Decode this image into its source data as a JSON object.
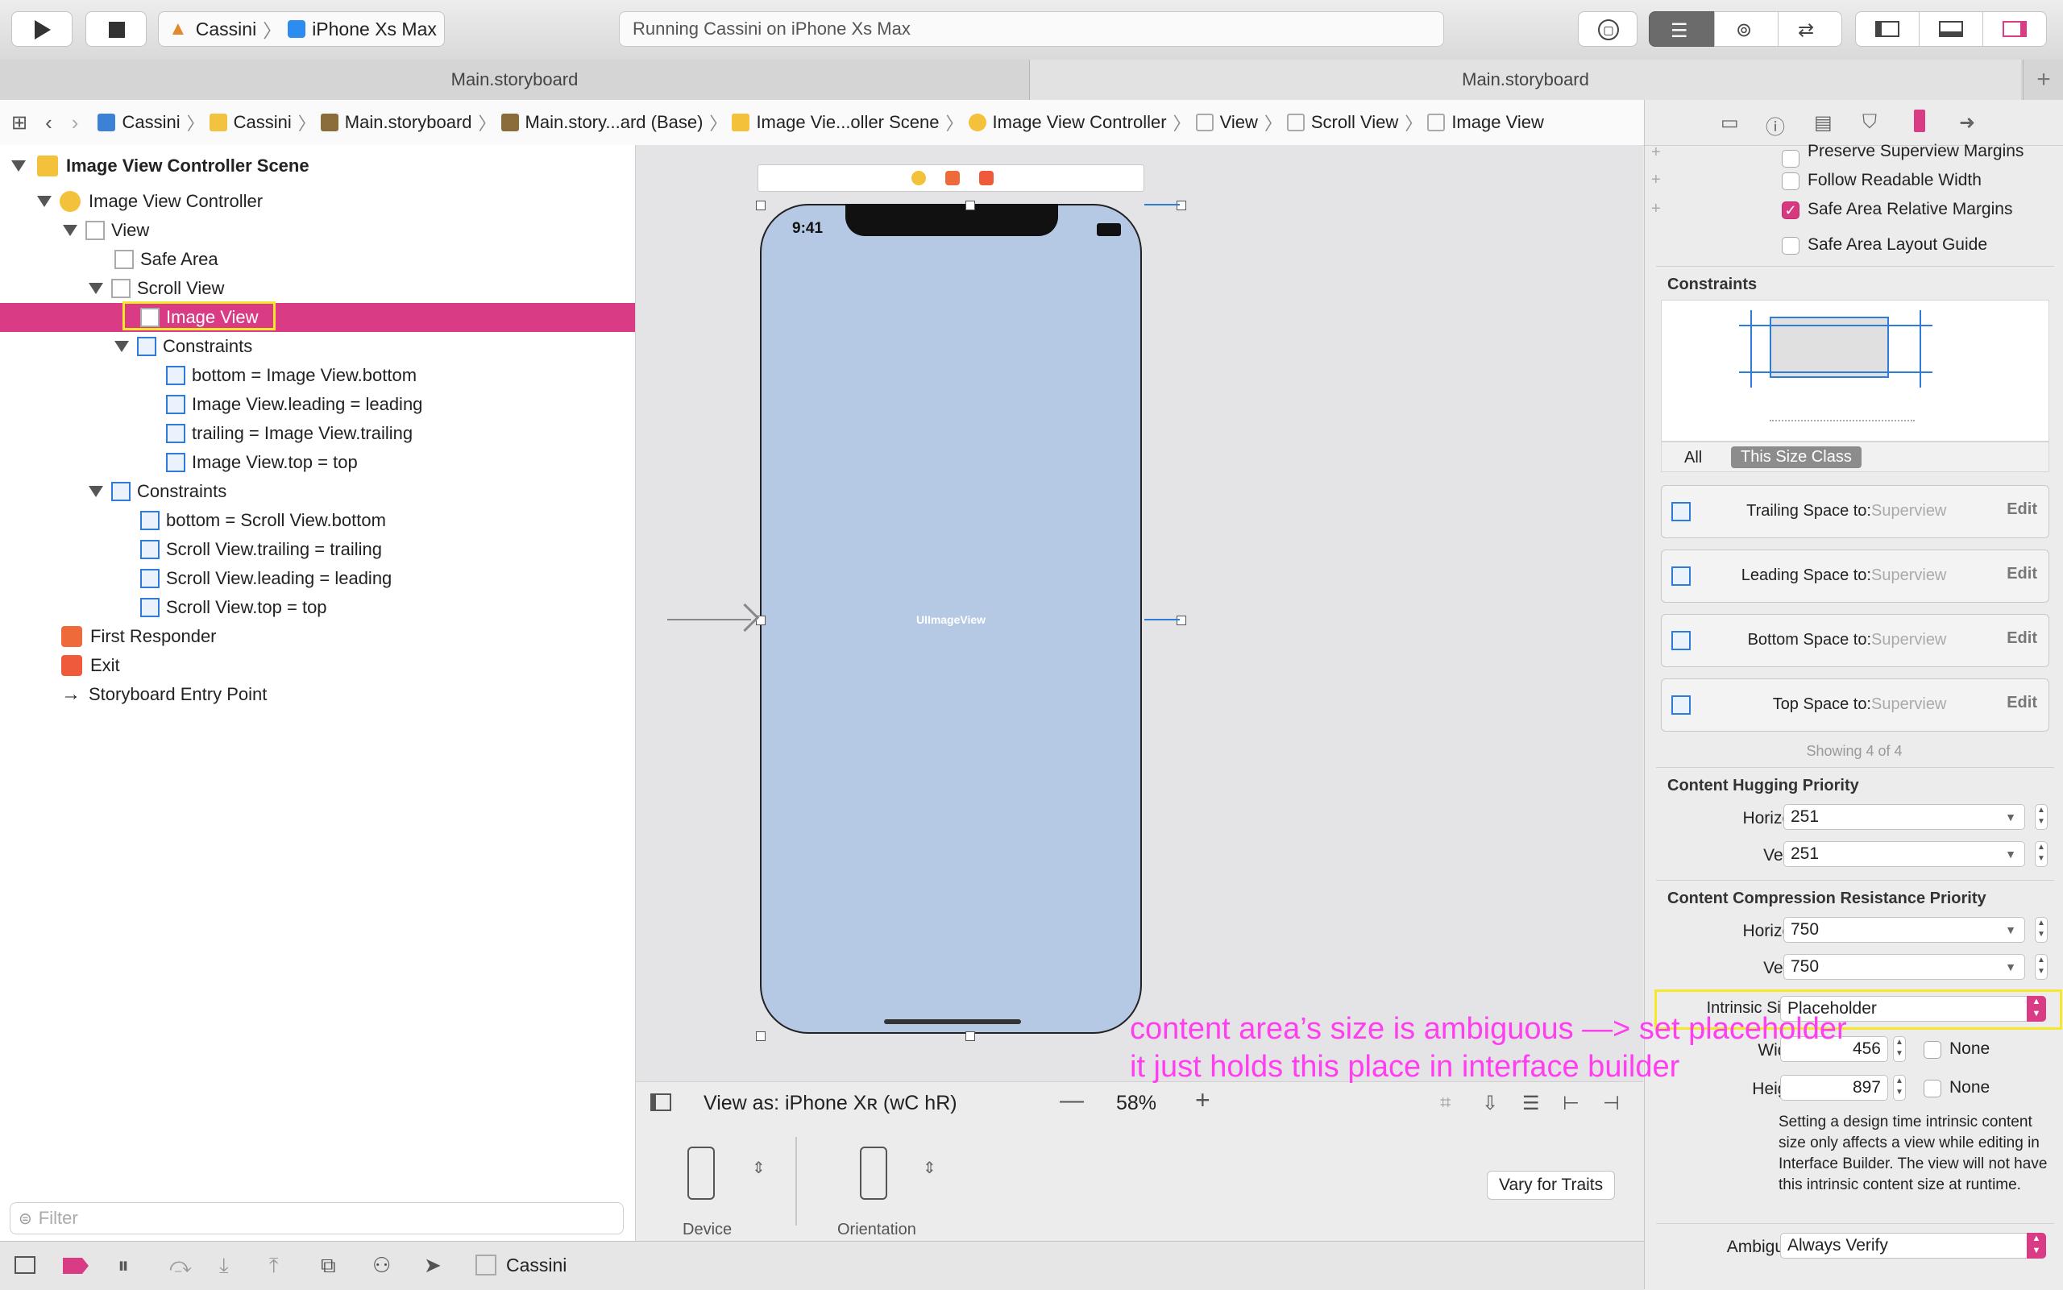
{
  "toolbar": {
    "scheme_project": "Cassini",
    "scheme_device": "iPhone Xs Max",
    "status": "Running Cassini on iPhone Xs Max"
  },
  "tabs": [
    "Main.storyboard",
    "Main.storyboard"
  ],
  "jumpbar": [
    "Cassini",
    "Cassini",
    "Main.storyboard",
    "Main.story...ard (Base)",
    "Image Vie...oller Scene",
    "Image View Controller",
    "View",
    "Scroll View",
    "Image View"
  ],
  "outline": {
    "scene": "Image View Controller Scene",
    "controller": "Image View Controller",
    "view": "View",
    "safe_area": "Safe Area",
    "scroll_view": "Scroll View",
    "image_view": "Image View",
    "constraints_label": "Constraints",
    "iv_constraints": [
      "bottom = Image View.bottom",
      "Image View.leading = leading",
      "trailing = Image View.trailing",
      "Image View.top = top"
    ],
    "sv_constraints": [
      "bottom = Scroll View.bottom",
      "Scroll View.trailing = trailing",
      "Scroll View.leading = leading",
      "Scroll View.top = top"
    ],
    "first_responder": "First Responder",
    "exit": "Exit",
    "entry_point": "Storyboard Entry Point",
    "filter_placeholder": "Filter"
  },
  "canvas": {
    "time": "9:41",
    "image_view_label": "UIImageView",
    "view_as": "View as: iPhone Xʀ (wC hR)",
    "zoom": "58%",
    "device_label": "Device",
    "orientation_label": "Orientation",
    "vary_button": "Vary for Traits"
  },
  "inspector": {
    "checkbox_preserve": "Preserve Superview Margins",
    "checkbox_readable": "Follow Readable Width",
    "checkbox_safe_margins": "Safe Area Relative Margins",
    "checkbox_safe_guide": "Safe Area Layout Guide",
    "constraints_header": "Constraints",
    "filter_all": "All",
    "filter_size_class": "This Size Class",
    "constraint_rows": [
      {
        "label": "Trailing Space to:",
        "target": "Superview",
        "edit": "Edit"
      },
      {
        "label": "Leading Space to:",
        "target": "Superview",
        "edit": "Edit"
      },
      {
        "label": "Bottom Space to:",
        "target": "Superview",
        "edit": "Edit"
      },
      {
        "label": "Top Space to:",
        "target": "Superview",
        "edit": "Edit"
      }
    ],
    "showing": "Showing 4 of 4",
    "hugging_header": "Content Hugging Priority",
    "hugging_h_label": "Horizontal",
    "hugging_h": "251",
    "hugging_v_label": "Vertical",
    "hugging_v": "251",
    "compression_header": "Content Compression Resistance Priority",
    "compression_h_label": "Horizontal",
    "compression_h": "750",
    "compression_v_label": "Vertical",
    "compression_v": "750",
    "intrinsic_label": "Intrinsic Size",
    "intrinsic_value": "Placeholder",
    "width_label": "Width",
    "width_value": "456",
    "height_label": "Height",
    "height_value": "897",
    "none_label": "None",
    "note": "Setting a design time intrinsic content size only affects a view while editing in Interface Builder. The view will not have this intrinsic content size at runtime.",
    "ambiguity_label": "Ambiguity",
    "ambiguity_value": "Always Verify"
  },
  "bottombar": {
    "target": "Cassini"
  },
  "annotation": {
    "line1": "content area’s size is ambiguous —> set placeholder",
    "line2": "it just holds this place in interface builder"
  },
  "colors": {
    "selection": "#d93b84",
    "highlight_box": "#f5e72a",
    "annotation": "#ff3ef0",
    "phone_fill": "#b5c9e4"
  }
}
